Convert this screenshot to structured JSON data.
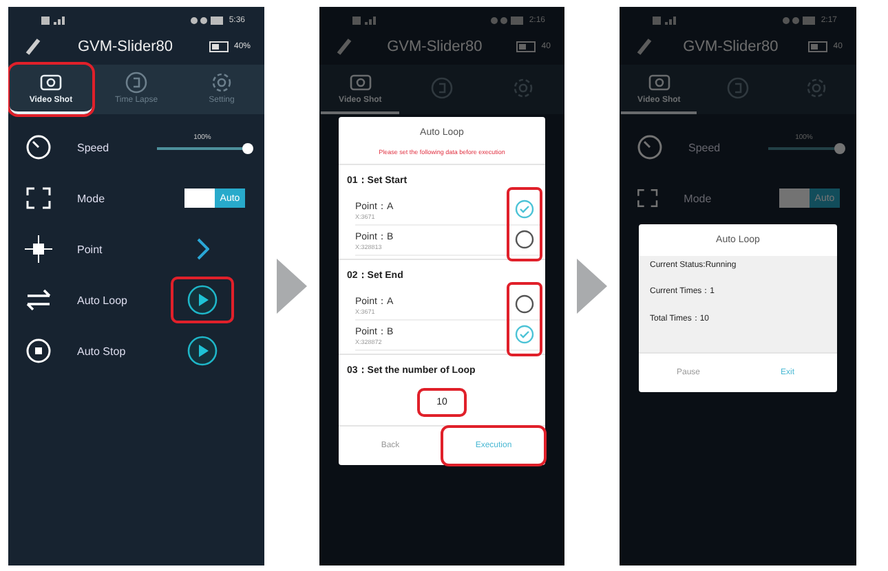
{
  "phones": [
    {
      "status_bar": {
        "time": "5:36"
      },
      "header": {
        "title": "GVM-Slider80",
        "battery": "40%"
      },
      "tabs": [
        {
          "label": "Video Shot",
          "selected": true,
          "highlighted": true
        },
        {
          "label": "Time Lapse",
          "selected": false,
          "highlighted": false
        },
        {
          "label": "Setting",
          "selected": false,
          "highlighted": false
        }
      ],
      "rows": [
        {
          "kind": "slider",
          "label": "Speed",
          "reading": "100%",
          "level": 1
        },
        {
          "kind": "toggle",
          "label": "Mode",
          "value": "Auto",
          "on": true
        },
        {
          "kind": "link",
          "label": "Point"
        },
        {
          "kind": "play",
          "label": "Auto Loop",
          "highlighted": true
        },
        {
          "kind": "play",
          "label": "Auto Stop",
          "highlighted": false
        }
      ]
    },
    {
      "status_bar": {
        "time": "2:16"
      },
      "header": {
        "title": "GVM-Slider80",
        "battery": "40"
      },
      "tabs": [
        {
          "label": "Video Shot",
          "selected": true,
          "highlighted": false
        },
        {
          "selected": false,
          "highlighted": false
        },
        {
          "selected": false,
          "highlighted": false
        }
      ],
      "dialog": {
        "kind": "setup",
        "title": "Auto Loop",
        "notice": "Please set the following data before execution",
        "sections": [
          {
            "heading": "01：Set Start",
            "highlighted": true,
            "points": [
              {
                "label": "Point：A",
                "coord": "X:3671",
                "selected": true
              },
              {
                "label": "Point：B",
                "coord": "X:328813",
                "selected": false
              }
            ]
          },
          {
            "heading": "02：Set End",
            "highlighted": true,
            "points": [
              {
                "label": "Point：A",
                "coord": "X:3671",
                "selected": false
              },
              {
                "label": "Point：B",
                "coord": "X:328872",
                "selected": true
              }
            ]
          }
        ],
        "loop": {
          "heading": "03：Set the number of Loop",
          "value": "10",
          "highlighted": true
        },
        "buttons": [
          {
            "label": "Back",
            "primary": false,
            "highlighted": false
          },
          {
            "label": "Execution",
            "primary": true,
            "highlighted": true
          }
        ]
      }
    },
    {
      "status_bar": {
        "time": "2:17"
      },
      "header": {
        "title": "GVM-Slider80",
        "battery": "40"
      },
      "tabs": [
        {
          "label": "Video Shot",
          "selected": true,
          "highlighted": false
        },
        {
          "selected": false,
          "highlighted": false
        },
        {
          "selected": false,
          "highlighted": false
        }
      ],
      "rows": [
        {
          "kind": "slider",
          "label": "Speed",
          "reading": "100%",
          "level": 1
        },
        {
          "kind": "toggle",
          "label": "Mode",
          "value": "Auto",
          "on": true
        }
      ],
      "dialog": {
        "kind": "status",
        "title": "Auto Loop",
        "lines": [
          "Current Status:Running",
          "Current Times：1",
          "Total Times：10"
        ],
        "buttons": [
          {
            "label": "Pause",
            "primary": false,
            "highlighted": false
          },
          {
            "label": "Exit",
            "primary": true,
            "highlighted": false
          }
        ]
      }
    }
  ]
}
